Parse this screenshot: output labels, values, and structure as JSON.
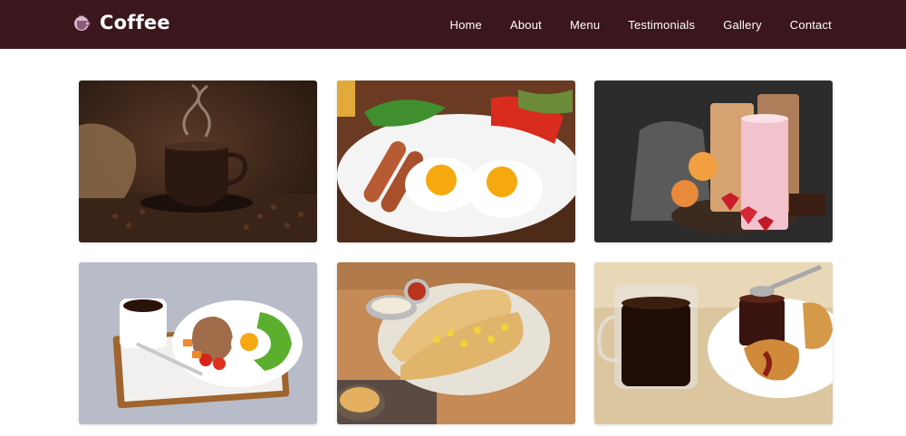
{
  "brand": {
    "name": "Coffee",
    "icon": "coffee-cup-icon"
  },
  "nav": {
    "links": [
      "Home",
      "About",
      "Menu",
      "Testimonials",
      "Gallery",
      "Contact"
    ]
  },
  "gallery": {
    "images": [
      {
        "subject": "steaming-coffee-cup"
      },
      {
        "subject": "eggs-sausages-breakfast"
      },
      {
        "subject": "smoothies-and-fruit"
      },
      {
        "subject": "tray-breakfast-with-coffee"
      },
      {
        "subject": "breakfast-wraps-with-sauces"
      },
      {
        "subject": "coffee-and-croissant"
      }
    ]
  },
  "colors": {
    "navbar": "#3b161d",
    "text": "#ffffff"
  }
}
